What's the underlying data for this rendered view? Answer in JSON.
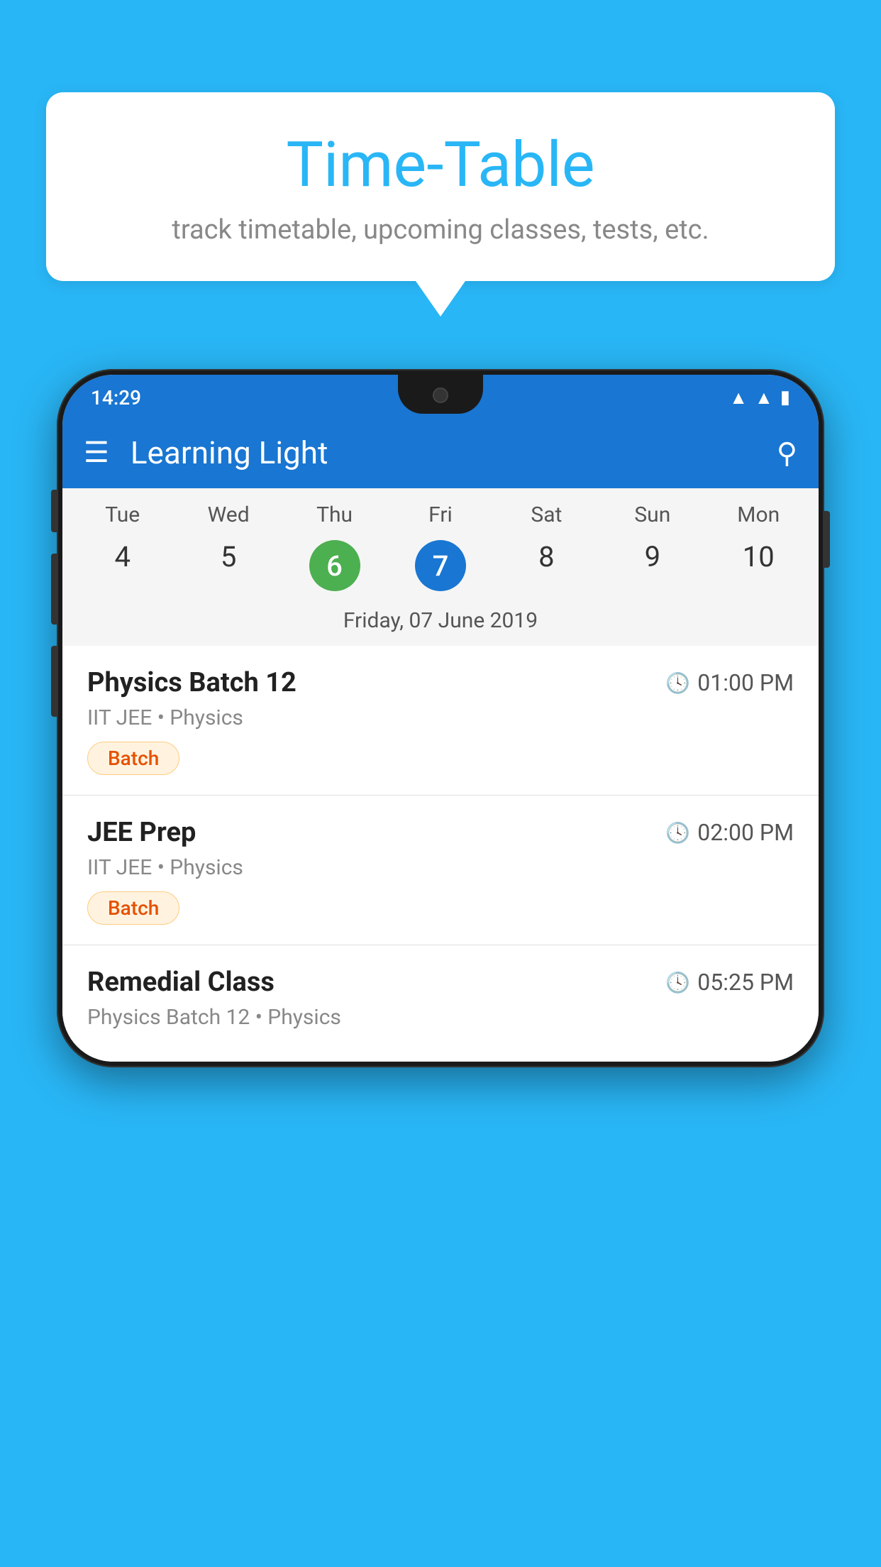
{
  "background_color": "#29B6F6",
  "speech_bubble": {
    "title": "Time-Table",
    "subtitle": "track timetable, upcoming classes, tests, etc."
  },
  "status_bar": {
    "time": "14:29",
    "icons": [
      "wifi",
      "signal",
      "battery"
    ]
  },
  "app_bar": {
    "title": "Learning Light"
  },
  "calendar": {
    "days": [
      {
        "label": "Tue",
        "number": "4"
      },
      {
        "label": "Wed",
        "number": "5"
      },
      {
        "label": "Thu",
        "number": "6",
        "type": "today"
      },
      {
        "label": "Fri",
        "number": "7",
        "type": "selected"
      },
      {
        "label": "Sat",
        "number": "8"
      },
      {
        "label": "Sun",
        "number": "9"
      },
      {
        "label": "Mon",
        "number": "10"
      }
    ],
    "selected_date": "Friday, 07 June 2019"
  },
  "schedule": [
    {
      "title": "Physics Batch 12",
      "time": "01:00 PM",
      "subtitle": "IIT JEE • Physics",
      "badge": "Batch"
    },
    {
      "title": "JEE Prep",
      "time": "02:00 PM",
      "subtitle": "IIT JEE • Physics",
      "badge": "Batch"
    },
    {
      "title": "Remedial Class",
      "time": "05:25 PM",
      "subtitle": "Physics Batch 12 • Physics",
      "badge": ""
    }
  ]
}
